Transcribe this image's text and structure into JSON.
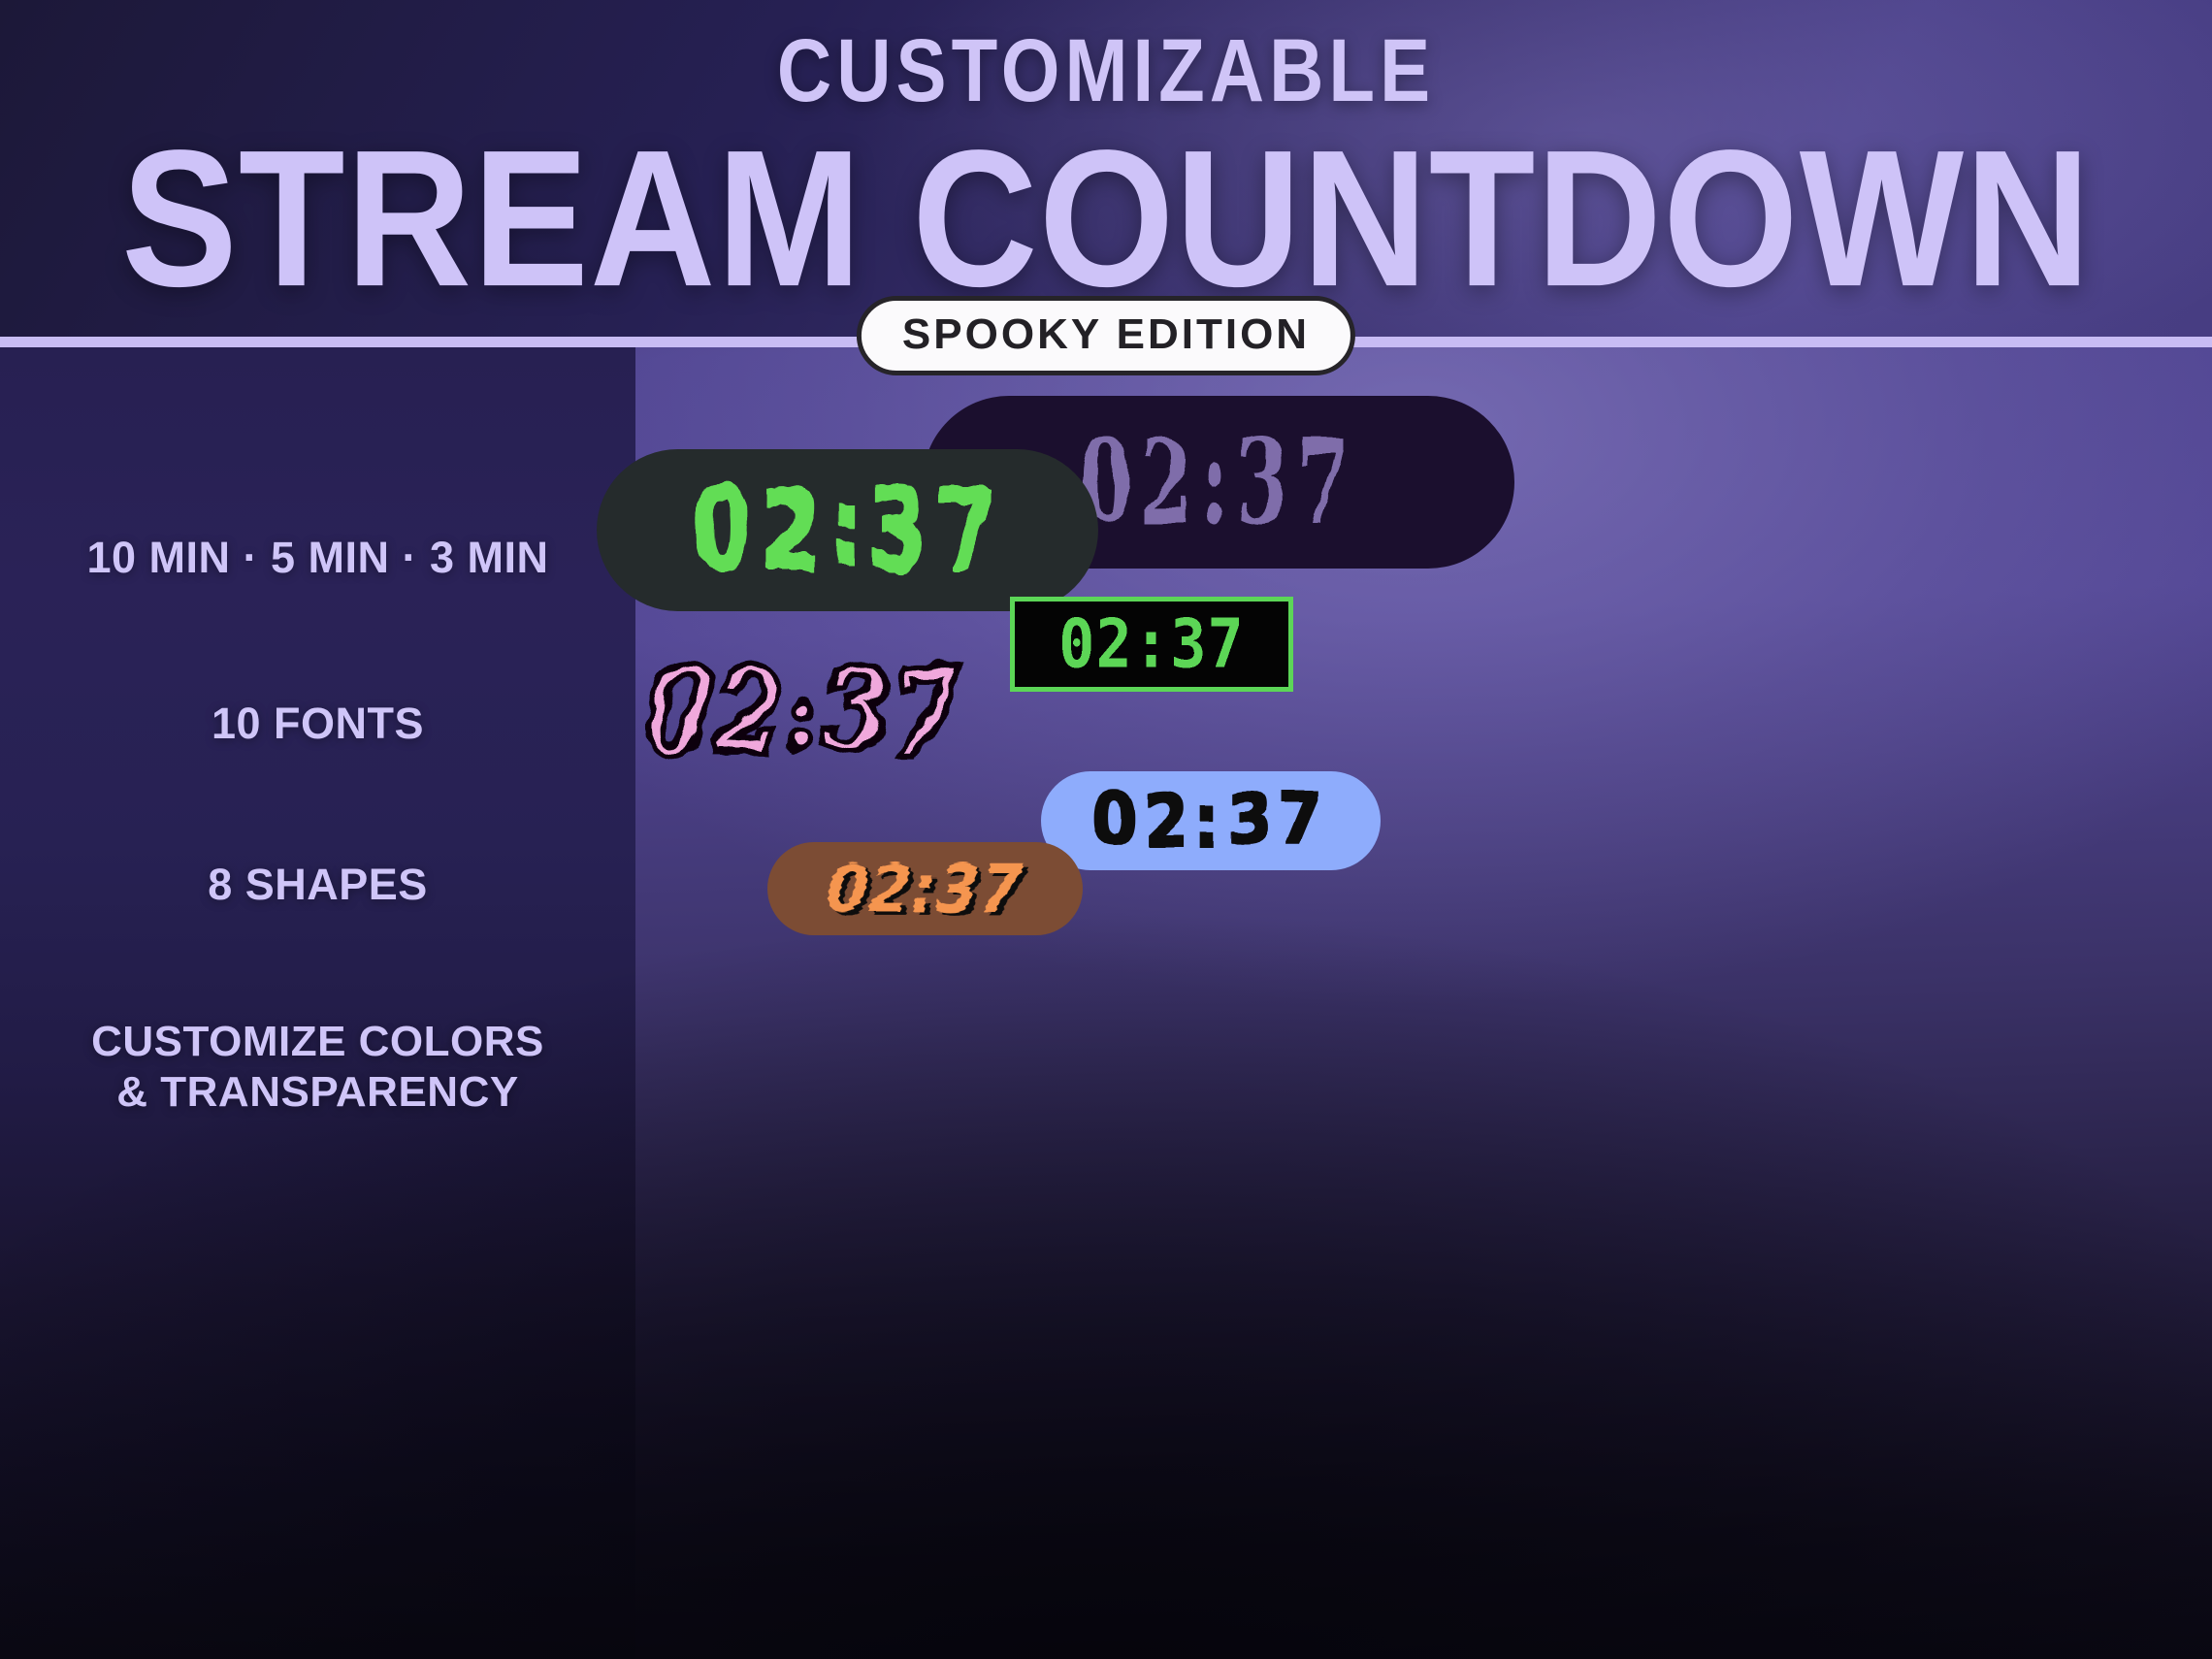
{
  "header": {
    "kicker": "CUSTOMIZABLE",
    "headline": "STREAM COUNTDOWN",
    "badge": "SPOOKY EDITION"
  },
  "sidebar": {
    "features": [
      {
        "label": "10 MIN · 5 MIN · 3 MIN"
      },
      {
        "label": "10 FONTS"
      },
      {
        "label": "8 SHAPES"
      },
      {
        "label": "CUSTOMIZE COLORS\n& TRANSPARENCY"
      }
    ]
  },
  "widgets": [
    {
      "style": "slime-drip",
      "time": "02:37",
      "shape": "pill",
      "bg_color": "#252B2C",
      "text_color": "#62DD55"
    },
    {
      "style": "gothic-blackletter",
      "time": "02:37",
      "shape": "pill",
      "bg_color": "#1B0F2E",
      "text_color": "#7F6DAA"
    },
    {
      "style": "pixel-lcd",
      "time": "02:37",
      "shape": "rectangle-outline",
      "bg_color": "#040404",
      "text_color": "#5CD657",
      "border_color": "#5CD657"
    },
    {
      "style": "pink-blob-outline",
      "time": "02:37",
      "shape": "none",
      "bg_color": "transparent",
      "text_color": "#F0A8DC",
      "outline_color": "#07060A"
    },
    {
      "style": "blue-graffiti",
      "time": "02:37",
      "shape": "pill",
      "bg_color": "#8EACFC",
      "text_color": "#0B0A10"
    },
    {
      "style": "orange-glitch",
      "time": "02:37",
      "shape": "pill",
      "bg_color": "#7C4C34",
      "text_color": "#F5954F",
      "shadow_color": "#0A0A0C"
    }
  ],
  "theme": {
    "accent_lavender": "#CFC4F7",
    "divider": "#C8BCF4",
    "badge_bg": "#FBFAFC",
    "badge_text": "#232126",
    "bg_purple": "#4E4390",
    "bg_dark": "#0B0914"
  }
}
